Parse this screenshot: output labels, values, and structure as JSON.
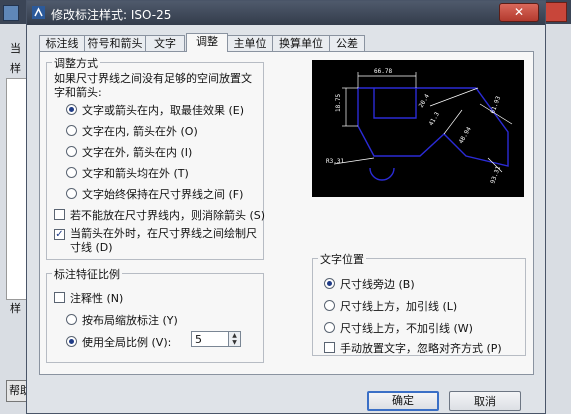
{
  "window": {
    "title": "修改标注样式: ISO-25",
    "close": "✕"
  },
  "background": {
    "label_top": "当",
    "label_top2": "样",
    "label_mid": "样",
    "help": "帮助"
  },
  "tabs": [
    {
      "label": "标注线",
      "active": false
    },
    {
      "label": "符号和箭头",
      "active": false
    },
    {
      "label": "文字",
      "active": false
    },
    {
      "label": "调整",
      "active": true
    },
    {
      "label": "主单位",
      "active": false
    },
    {
      "label": "换算单位",
      "active": false
    },
    {
      "label": "公差",
      "active": false
    }
  ],
  "fit": {
    "title": "调整方式",
    "description": "如果尺寸界线之间没有足够的空间放置文字和箭头:",
    "options": [
      {
        "label": "文字或箭头在内，取最佳效果 (E)",
        "selected": true
      },
      {
        "label": "文字在内, 箭头在外 (O)",
        "selected": false
      },
      {
        "label": "文字在外, 箭头在内 (I)",
        "selected": false
      },
      {
        "label": "文字和箭头均在外 (T)",
        "selected": false
      },
      {
        "label": "文字始终保持在尺寸界线之间 (F)",
        "selected": false
      }
    ],
    "suppress_arrows": {
      "label": "若不能放在尺寸界线内，则消除箭头 (S)",
      "checked": false
    },
    "draw_dimline": {
      "label": "当箭头在外时，在尺寸界线之间绘制尺寸线 (D)",
      "checked": true
    }
  },
  "scale": {
    "title": "标注特征比例",
    "annotative": {
      "label": "注释性 (N)",
      "checked": false
    },
    "layout_scale": {
      "label": "按布局缩放标注 (Y)",
      "selected": false
    },
    "overall_scale": {
      "label": "使用全局比例 (V):",
      "selected": true
    },
    "value": "5"
  },
  "text_placement": {
    "title": "文字位置",
    "options": [
      {
        "label": "尺寸线旁边 (B)",
        "selected": true
      },
      {
        "label": "尺寸线上方，加引线 (L)",
        "selected": false
      },
      {
        "label": "尺寸线上方，不加引线 (W)",
        "selected": false
      }
    ],
    "manual": {
      "label": "手动放置文字，忽略对齐方式 (P)",
      "checked": false
    }
  },
  "preview": {
    "dims": [
      "66.78",
      "18.75",
      "20.4",
      "61.93",
      "R3.31",
      "41.3",
      "48.94",
      "93.31"
    ],
    "colors": {
      "shape": "#2b2bd6",
      "dims": "#ffffff"
    }
  },
  "buttons": {
    "ok": "确定",
    "cancel": "取消"
  },
  "colors": {
    "dialog_bg": "#dfe3e8",
    "panel_bg": "#f7f7f7",
    "titlebar": "#3b4556",
    "accent": "#3a6fc6"
  }
}
